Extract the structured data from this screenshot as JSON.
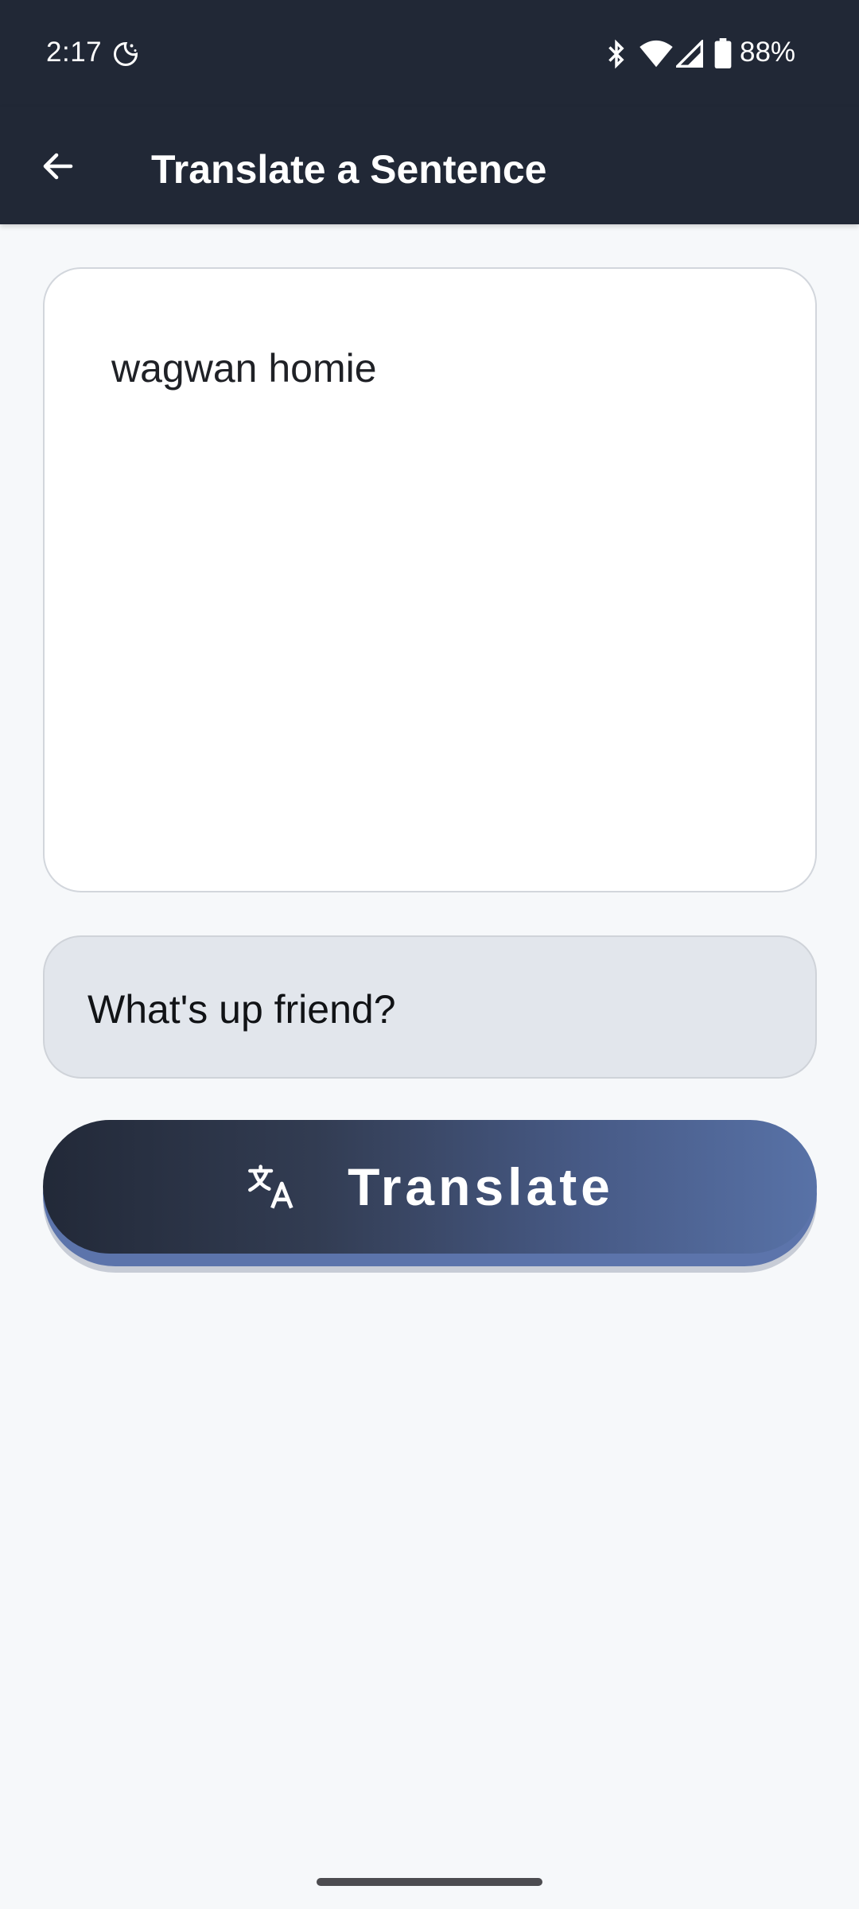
{
  "status_bar": {
    "time": "2:17",
    "battery": "88%",
    "icons": [
      "moon-icon",
      "bluetooth-icon",
      "wifi-icon",
      "signal-icon",
      "battery-icon"
    ]
  },
  "app_bar": {
    "title": "Translate a Sentence",
    "back_icon": "arrow-left-icon"
  },
  "input": {
    "text": "wagwan homie"
  },
  "output": {
    "text": "What's up friend?"
  },
  "translate_button": {
    "label": "Translate",
    "icon": "translate-icon"
  },
  "colors": {
    "bar_background": "#212836",
    "page_background": "#f6f8fa",
    "output_background": "#e2e6ec",
    "button_gradient_start": "#222938",
    "button_gradient_end": "#5872a7"
  }
}
